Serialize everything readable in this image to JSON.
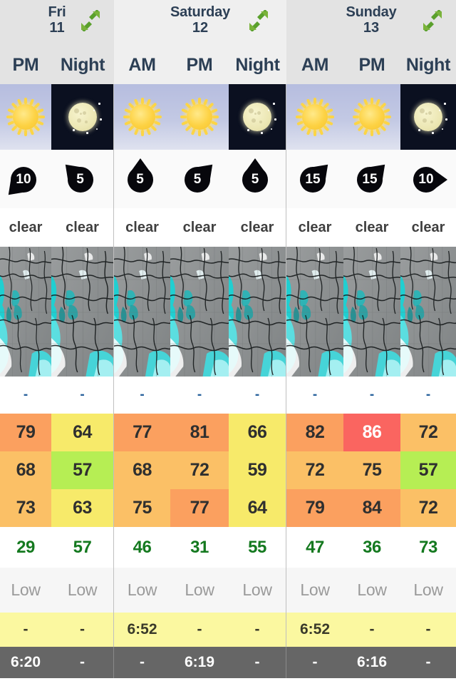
{
  "days": [
    {
      "name": "Fri",
      "num": "11",
      "expand_icon": "expand-arrows-icon"
    },
    {
      "name": "Saturday",
      "num": "12",
      "expand_icon": "expand-arrows-icon"
    },
    {
      "name": "Sunday",
      "num": "13",
      "expand_icon": "expand-arrows-icon"
    }
  ],
  "columns": [
    {
      "period": "PM",
      "sky": "day",
      "sky_icon": "sun-icon",
      "wind_speed": "10",
      "wind_dir_deg": 225,
      "condition": "clear",
      "precip": "-",
      "temp_max": "79",
      "temp_mid": "68",
      "temp_min": "73",
      "humidity": "29",
      "risk": "Low",
      "sunrise": "-",
      "sunset": "6:20"
    },
    {
      "period": "Night",
      "sky": "night",
      "sky_icon": "moon-icon",
      "wind_speed": "5",
      "wind_dir_deg": 315,
      "condition": "clear",
      "precip": "-",
      "temp_max": "64",
      "temp_mid": "57",
      "temp_min": "63",
      "humidity": "57",
      "risk": "Low",
      "sunrise": "-",
      "sunset": "-"
    },
    {
      "period": "AM",
      "sky": "day",
      "sky_icon": "sun-icon",
      "wind_speed": "5",
      "wind_dir_deg": 0,
      "condition": "clear",
      "precip": "-",
      "temp_max": "77",
      "temp_mid": "68",
      "temp_min": "75",
      "humidity": "46",
      "risk": "Low",
      "sunrise": "6:52",
      "sunset": "-"
    },
    {
      "period": "PM",
      "sky": "day",
      "sky_icon": "sun-icon",
      "wind_speed": "5",
      "wind_dir_deg": 45,
      "condition": "clear",
      "precip": "-",
      "temp_max": "81",
      "temp_mid": "72",
      "temp_min": "77",
      "humidity": "31",
      "risk": "Low",
      "sunrise": "-",
      "sunset": "6:19"
    },
    {
      "period": "Night",
      "sky": "night",
      "sky_icon": "moon-icon",
      "wind_speed": "5",
      "wind_dir_deg": 0,
      "condition": "clear",
      "precip": "-",
      "temp_max": "66",
      "temp_mid": "59",
      "temp_min": "64",
      "humidity": "55",
      "risk": "Low",
      "sunrise": "-",
      "sunset": "-"
    },
    {
      "period": "AM",
      "sky": "day",
      "sky_icon": "sun-icon",
      "wind_speed": "15",
      "wind_dir_deg": 45,
      "condition": "clear",
      "precip": "-",
      "temp_max": "82",
      "temp_mid": "72",
      "temp_min": "79",
      "humidity": "47",
      "risk": "Low",
      "sunrise": "6:52",
      "sunset": "-"
    },
    {
      "period": "PM",
      "sky": "day",
      "sky_icon": "sun-icon",
      "wind_speed": "15",
      "wind_dir_deg": 45,
      "condition": "clear",
      "precip": "-",
      "temp_max": "86",
      "temp_mid": "75",
      "temp_min": "84",
      "humidity": "36",
      "risk": "Low",
      "sunrise": "-",
      "sunset": "6:16"
    },
    {
      "period": "Night",
      "sky": "night",
      "sky_icon": "moon-icon",
      "wind_speed": "10",
      "wind_dir_deg": 90,
      "condition": "clear",
      "precip": "-",
      "temp_max": "72",
      "temp_mid": "57",
      "temp_min": "72",
      "humidity": "73",
      "risk": "Low",
      "sunrise": "-",
      "sunset": "-"
    }
  ],
  "temp_colors": {
    "row1": [
      "#fba05f",
      "#f7ea6a",
      "#fba05f",
      "#fba05f",
      "#f7ea6a",
      "#fba05f",
      "#fa6560",
      "#fbc066"
    ],
    "row2": [
      "#fbc066",
      "#b6ee54",
      "#fbc066",
      "#fbc066",
      "#f7ea6a",
      "#fbc066",
      "#fbc066",
      "#b6ee54"
    ],
    "row3": [
      "#fbc066",
      "#f7ea6a",
      "#fbc066",
      "#fba05f",
      "#f7ea6a",
      "#fba05f",
      "#fba05f",
      "#fbc066"
    ]
  },
  "temp_text_colors": {
    "row1": [
      "#2f2f2f",
      "#2f2f2f",
      "#2f2f2f",
      "#2f2f2f",
      "#2f2f2f",
      "#2f2f2f",
      "#ffffff",
      "#2f2f2f"
    ],
    "row2": [
      "#2f2f2f",
      "#2f2f2f",
      "#2f2f2f",
      "#2f2f2f",
      "#2f2f2f",
      "#2f2f2f",
      "#2f2f2f",
      "#2f2f2f"
    ],
    "row3": [
      "#2f2f2f",
      "#2f2f2f",
      "#2f2f2f",
      "#2f2f2f",
      "#2f2f2f",
      "#2f2f2f",
      "#2f2f2f",
      "#2f2f2f"
    ]
  },
  "palette": {
    "header_bg": "#e3e3e3",
    "header_bg_alt": "#efefef",
    "header_text": "#2c3f55",
    "expand_arrow": "#5aa02c",
    "humidity_text": "#14791f",
    "risk_text": "#9a9a9a",
    "precip_text": "#27609b",
    "sunrise_bg": "#fbf8a0",
    "sunset_bg": "#666666",
    "sky_day": "#b6bddf",
    "sky_night": "#0b1020",
    "map_land": "#8d9091",
    "map_precip": "#1ad6d6"
  }
}
